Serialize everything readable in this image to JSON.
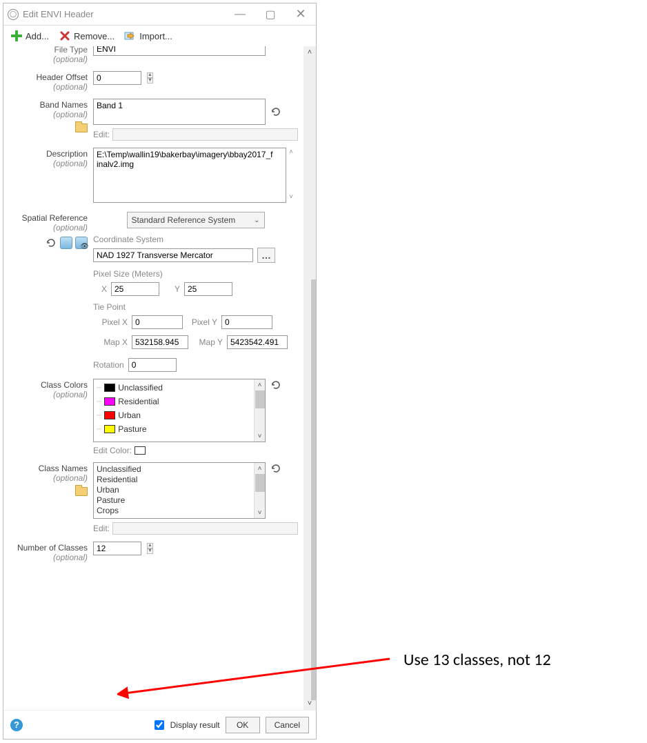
{
  "window": {
    "title": "Edit ENVI Header",
    "minimize": "—",
    "close": "✕"
  },
  "toolbar": {
    "add": "Add...",
    "remove": "Remove...",
    "import": "Import..."
  },
  "form": {
    "fileType": {
      "label": "File Type",
      "opt": "(optional)",
      "value": "ENVI"
    },
    "headerOffset": {
      "label": "Header Offset",
      "opt": "(optional)",
      "value": "0"
    },
    "bandNames": {
      "label": "Band Names",
      "opt": "(optional)",
      "value": "Band 1",
      "edit": "Edit:"
    },
    "description": {
      "label": "Description",
      "opt": "(optional)",
      "value": "E:\\Temp\\wallin19\\bakerbay\\imagery\\bbay2017_finalv2.img"
    },
    "spatialRef": {
      "label": "Spatial Reference",
      "opt": "(optional)",
      "system": "Standard Reference System",
      "coordSysLabel": "Coordinate System",
      "coordSys": "NAD 1927 Transverse Mercator",
      "pixelSizeLabel": "Pixel Size (Meters)",
      "xLabel": "X",
      "x": "25",
      "yLabel": "Y",
      "y": "25",
      "tiePointLabel": "Tie Point",
      "pxLabel": "Pixel X",
      "px": "0",
      "pyLabel": "Pixel Y",
      "py": "0",
      "mxLabel": "Map X",
      "mx": "532158.945",
      "myLabel": "Map Y",
      "my": "5423542.491",
      "rotationLabel": "Rotation",
      "rotation": "0"
    },
    "classColors": {
      "label": "Class Colors",
      "opt": "(optional)",
      "editColor": "Edit Color:",
      "items": [
        {
          "name": "Unclassified",
          "color": "#000000"
        },
        {
          "name": "Residential",
          "color": "#ff00ff"
        },
        {
          "name": "Urban",
          "color": "#ff0000"
        },
        {
          "name": "Pasture",
          "color": "#ffff00"
        }
      ]
    },
    "classNames": {
      "label": "Class Names",
      "opt": "(optional)",
      "edit": "Edit:",
      "items": [
        "Unclassified",
        "Residential",
        "Urban",
        "Pasture",
        "Crops"
      ]
    },
    "numClasses": {
      "label": "Number of Classes",
      "opt": "(optional)",
      "value": "12"
    }
  },
  "bottom": {
    "display": "Display result",
    "ok": "OK",
    "cancel": "Cancel"
  },
  "annotation": {
    "text": "Use 13 classes, not 12"
  }
}
